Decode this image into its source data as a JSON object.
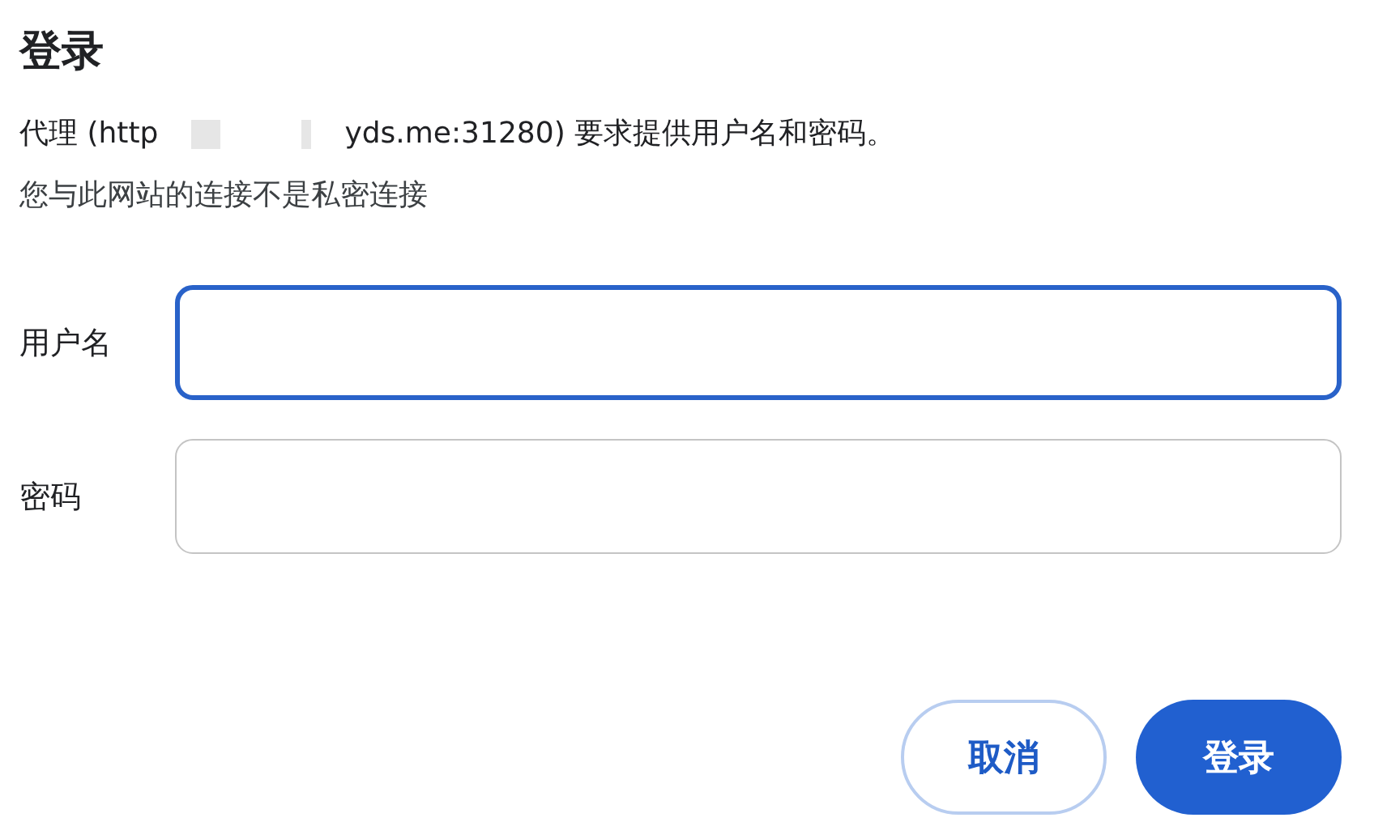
{
  "title": "登录",
  "message": {
    "before": "代理 (http",
    "after": "yds.me:31280) 要求提供用户名和密码。"
  },
  "notice": "您与此网站的连接不是私密连接",
  "fields": [
    {
      "label": "用户名",
      "focused": true
    },
    {
      "label": "密码",
      "focused": false
    }
  ],
  "buttons": [
    {
      "label": "取消",
      "kind": "secondary"
    },
    {
      "label": "登录",
      "kind": "primary"
    }
  ]
}
